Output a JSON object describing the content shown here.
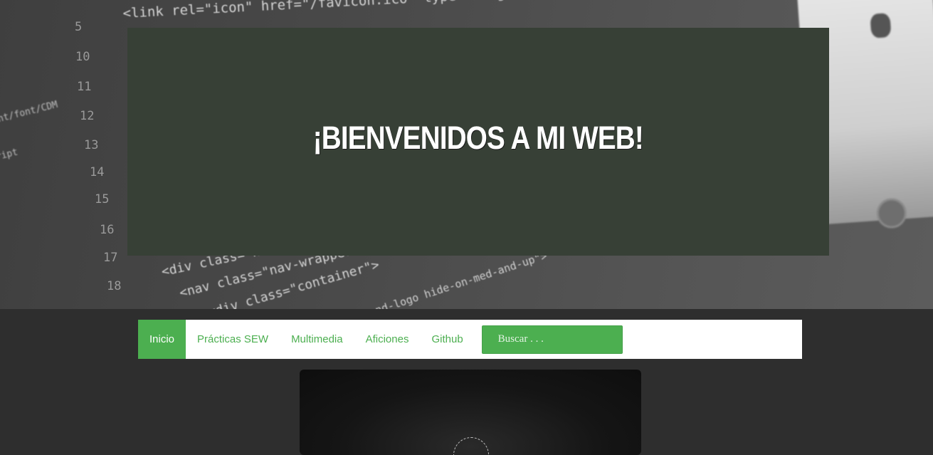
{
  "hero": {
    "title": "¡BIENVENIDOS A MI WEB!",
    "background_code": {
      "top_line": "<link rel=\"icon\" href=\"/favicon.ico\" type=\"image/x-icon\">",
      "lines": [
        "<div class=\"nav\">",
        "<nav class=\"nav-wrapper\">",
        "<div class=\"container\">",
        "nd-logo hide-on-med-and-up\">"
      ],
      "line_numbers": [
        "5",
        "10",
        "11",
        "12",
        "13",
        "14",
        "15",
        "16",
        "17",
        "18"
      ],
      "side_fragments": [
        "nt/font/CDM",
        "ript"
      ]
    },
    "banner_color": "#374036"
  },
  "nav": {
    "items": [
      {
        "label": "Inicio",
        "active": true
      },
      {
        "label": "Prácticas SEW",
        "active": false
      },
      {
        "label": "Multimedia",
        "active": false
      },
      {
        "label": "Aficiones",
        "active": false
      },
      {
        "label": "Github",
        "active": false
      }
    ],
    "search_placeholder": "Buscar . . .",
    "accent_color": "#4caf50"
  },
  "media": {
    "icon": "loading-ring-icon"
  }
}
